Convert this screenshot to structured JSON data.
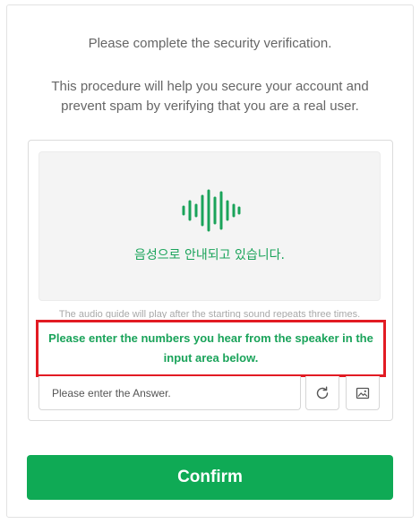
{
  "intro": {
    "line1": "Please complete the security verification.",
    "line2a": "This procedure will help you secure your account and",
    "line2b": "prevent spam by verifying that you are a real user."
  },
  "captcha": {
    "audio_status": "음성으로 안내되고 있습니다.",
    "audio_guide": "The audio guide will play after the starting sound repeats three times.",
    "instruction": "Please enter the numbers you hear from the speaker in the input area below.",
    "answer_placeholder": "Please enter the Answer.",
    "answer_value": "",
    "refresh_icon": "refresh-icon",
    "image_icon": "image-icon",
    "audio_icon": "sound-wave-icon"
  },
  "confirm": {
    "label": "Confirm"
  },
  "colors": {
    "accent": "#0faa55",
    "highlight_border": "#e21b23",
    "text_green": "#1aa35a"
  }
}
